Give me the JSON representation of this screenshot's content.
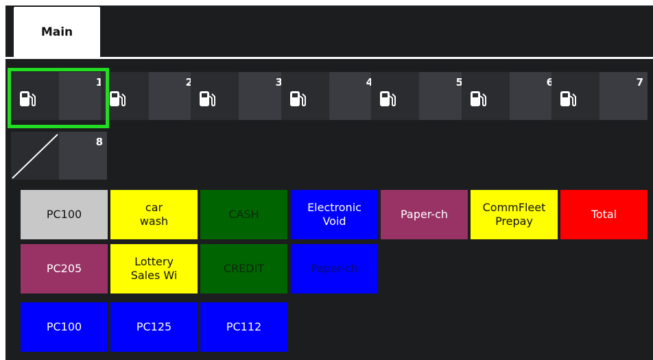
{
  "tabs": [
    {
      "label": "Main",
      "active": true
    }
  ],
  "pumps": [
    {
      "number": "1",
      "icon": "fuel-pump-icon",
      "selected": true
    },
    {
      "number": "2",
      "icon": "fuel-pump-icon"
    },
    {
      "number": "3",
      "icon": "fuel-pump-icon"
    },
    {
      "number": "4",
      "icon": "fuel-pump-icon"
    },
    {
      "number": "5",
      "icon": "fuel-pump-icon"
    },
    {
      "number": "6",
      "icon": "fuel-pump-icon"
    },
    {
      "number": "7",
      "icon": "fuel-pump-icon"
    },
    {
      "number": "8",
      "icon": "disabled-slash-icon"
    }
  ],
  "buttons": [
    {
      "label": "PC100",
      "bg": "#c8c8c8",
      "fg": "#111111"
    },
    {
      "label": "car\nwash",
      "bg": "#ffff00",
      "fg": "#111111"
    },
    {
      "label": "CASH",
      "bg": "#006400",
      "fg": "#0b2a0b"
    },
    {
      "label": "Electronic\nVoid",
      "bg": "#0000ff",
      "fg": "#ffffff"
    },
    {
      "label": "Paper-ch",
      "bg": "#993366",
      "fg": "#ffffff"
    },
    {
      "label": "CommFleet\nPrepay",
      "bg": "#ffff00",
      "fg": "#111111"
    },
    {
      "label": "Total",
      "bg": "#ff0000",
      "fg": "#ffffff"
    },
    {
      "label": "PC205",
      "bg": "#993366",
      "fg": "#ffffff"
    },
    {
      "label": "Lottery\nSales Wi",
      "bg": "#ffff00",
      "fg": "#111111"
    },
    {
      "label": "CREDIT",
      "bg": "#006400",
      "fg": "#0b2a0b"
    },
    {
      "label": "Paper-ch",
      "bg": "#0000ff",
      "fg": "#0a0a7a"
    },
    {
      "label": "PC100",
      "bg": "#0000ff",
      "fg": "#ffffff"
    },
    {
      "label": "PC125",
      "bg": "#0000ff",
      "fg": "#ffffff"
    },
    {
      "label": "PC112",
      "bg": "#0000ff",
      "fg": "#ffffff"
    }
  ],
  "colors": {
    "selection": "#22dd22",
    "background": "#1c1d1f"
  }
}
